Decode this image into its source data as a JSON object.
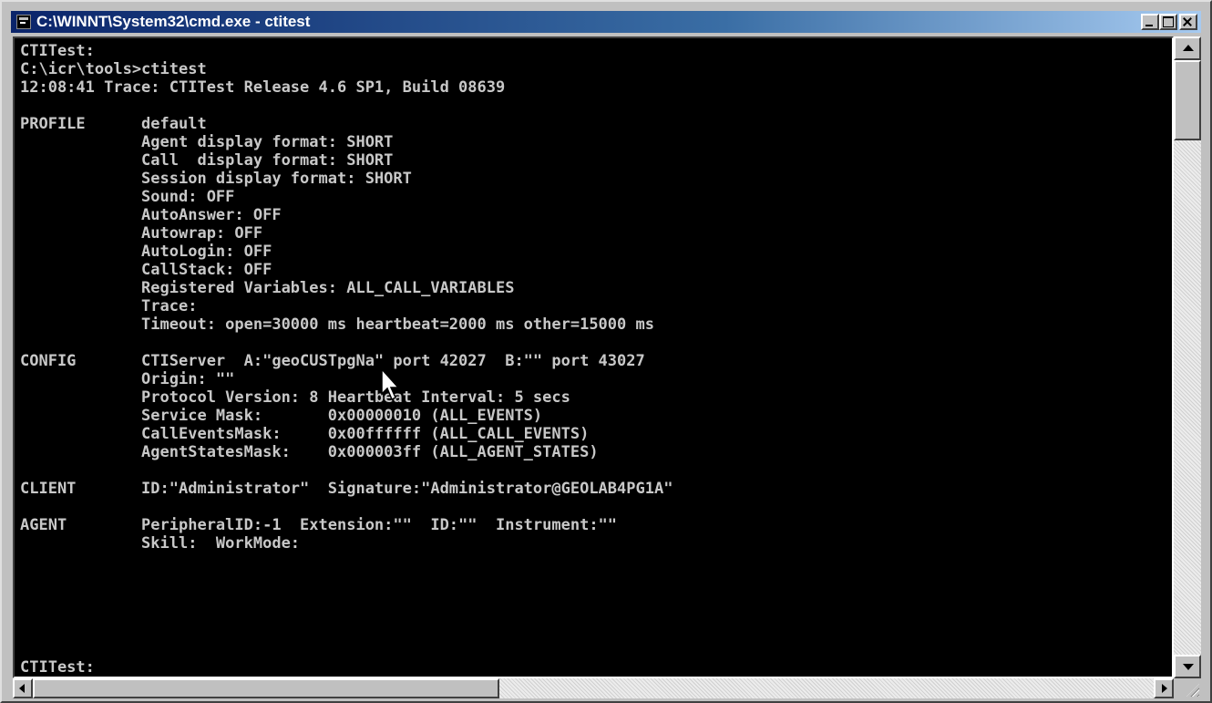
{
  "window": {
    "title": "C:\\WINNT\\System32\\cmd.exe - ctitest",
    "icon": "cmd-window-icon",
    "controls": [
      "minimize-icon",
      "maximize-icon",
      "close-icon"
    ]
  },
  "console": {
    "lines": [
      "CTITest:",
      "C:\\icr\\tools>ctitest",
      "12:08:41 Trace: CTITest Release 4.6 SP1, Build 08639",
      "",
      "PROFILE      default",
      "             Agent display format: SHORT",
      "             Call  display format: SHORT",
      "             Session display format: SHORT",
      "             Sound: OFF",
      "             AutoAnswer: OFF",
      "             Autowrap: OFF",
      "             AutoLogin: OFF",
      "             CallStack: OFF",
      "             Registered Variables: ALL_CALL_VARIABLES",
      "             Trace:",
      "             Timeout: open=30000 ms heartbeat=2000 ms other=15000 ms",
      "",
      "CONFIG       CTIServer  A:\"geoCUSTpgNa\" port 42027  B:\"\" port 43027",
      "             Origin: \"\"",
      "             Protocol Version: 8 Heartbeat Interval: 5 secs",
      "             Service Mask:       0x00000010 (ALL_EVENTS)",
      "             CallEventsMask:     0x00ffffff (ALL_CALL_EVENTS)",
      "             AgentStatesMask:    0x000003ff (ALL_AGENT_STATES)",
      "",
      "CLIENT       ID:\"Administrator\"  Signature:\"Administrator@GEOLAB4PG1A\"",
      "",
      "AGENT        PeripheralID:-1  Extension:\"\"  ID:\"\"  Instrument:\"\"",
      "             Skill:  WorkMode:",
      "",
      "CTITest:"
    ]
  },
  "scrollbars": {
    "vertical": [
      "scroll-up-icon",
      "scroll-down-icon"
    ],
    "horizontal": [
      "scroll-left-icon",
      "scroll-right-icon"
    ]
  },
  "colors": {
    "titlebar_start": "#0a246a",
    "titlebar_end": "#a6caf0",
    "console_bg": "#000000",
    "console_text": "#c8c8c8",
    "chrome": "#c0c0c0"
  }
}
